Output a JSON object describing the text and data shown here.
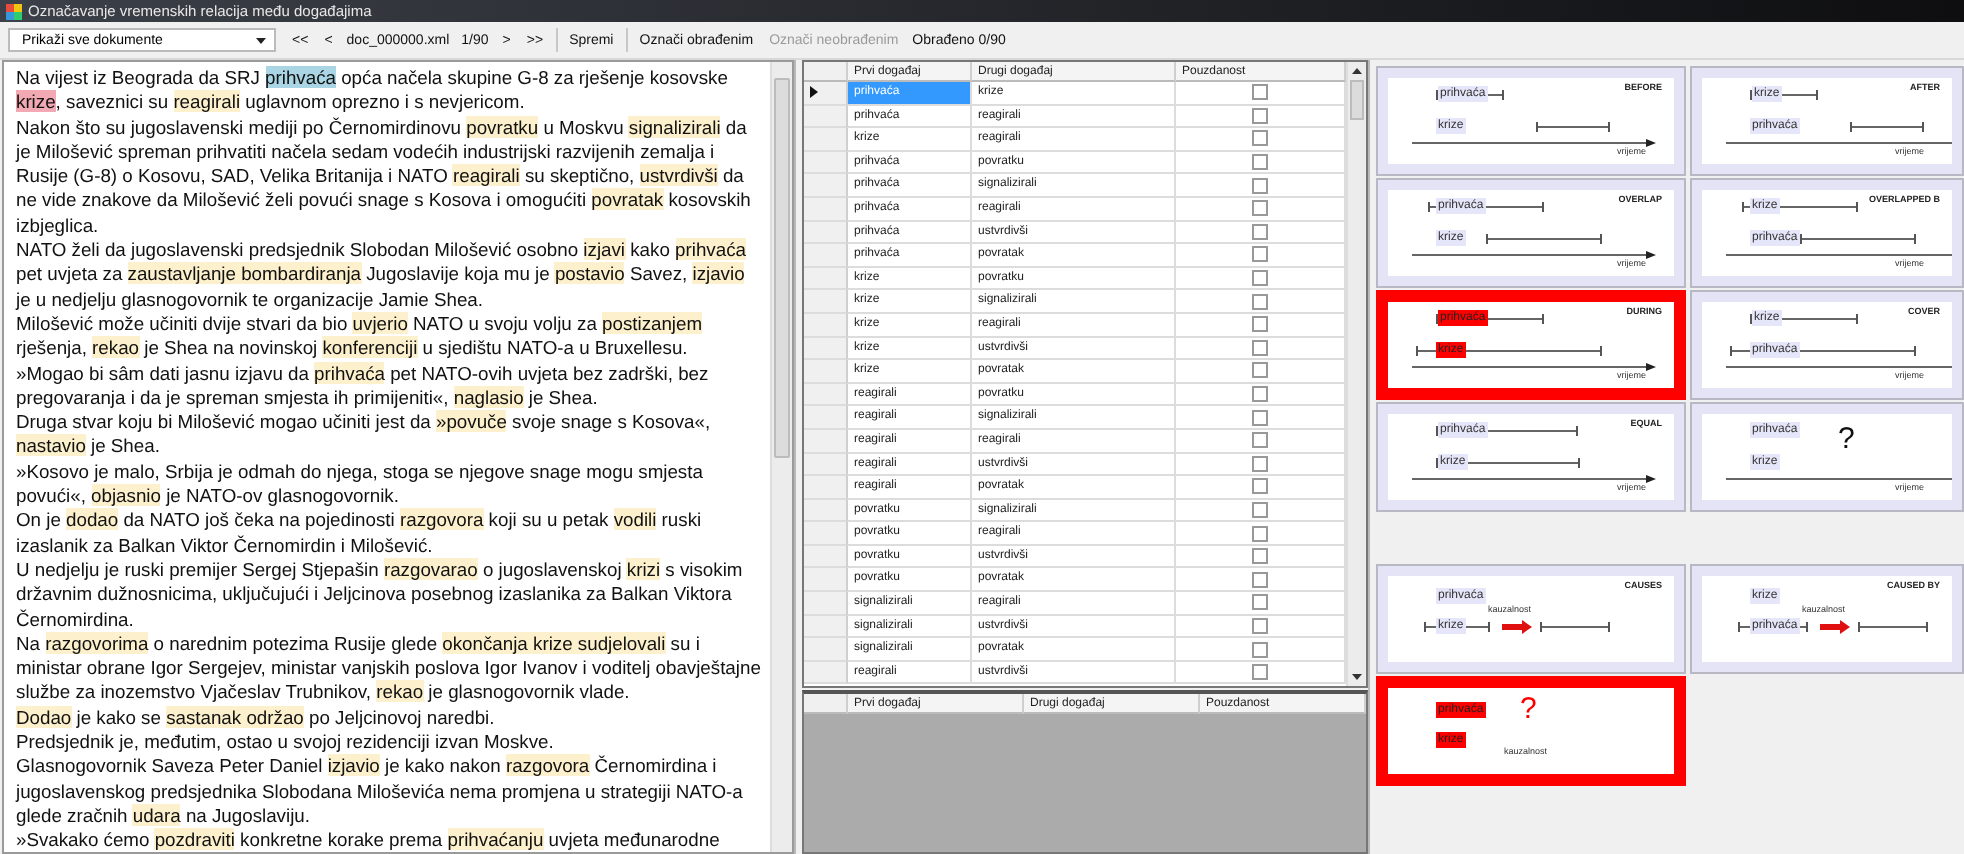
{
  "window": {
    "title": "Označavanje vremenskih relacija među događajima"
  },
  "toolbar": {
    "document_filter": "Prikaži sve dokumente",
    "items": [
      {
        "kind": "button",
        "label": "<<",
        "disabled": false
      },
      {
        "kind": "button",
        "label": "<",
        "disabled": false
      },
      {
        "kind": "label",
        "label": "doc_000000.xml"
      },
      {
        "kind": "label",
        "label": "1/90"
      },
      {
        "kind": "button",
        "label": ">",
        "disabled": false
      },
      {
        "kind": "button",
        "label": ">>",
        "disabled": false
      },
      {
        "kind": "separator"
      },
      {
        "kind": "button",
        "label": "Spremi",
        "disabled": false
      },
      {
        "kind": "separator"
      },
      {
        "kind": "button",
        "label": "Označi obrađenim",
        "disabled": false
      },
      {
        "kind": "button",
        "label": "Označi neobrađenim",
        "disabled": true
      },
      {
        "kind": "label",
        "label": "Obrađeno 0/90"
      }
    ]
  },
  "document": {
    "paragraphs": [
      [
        {
          "text": "Na vijest iz Beograda da SRJ ",
          "kind": "plain"
        },
        {
          "text": "prihvaća",
          "kind": "first"
        },
        {
          "text": " opća načela skupine G-8 za rješenje kosovske ",
          "kind": "plain"
        },
        {
          "text": "krize",
          "kind": "second"
        },
        {
          "text": ", saveznici su ",
          "kind": "plain"
        },
        {
          "text": "reagirali",
          "kind": "event"
        },
        {
          "text": " uglavnom oprezno i s nevjericom.",
          "kind": "plain"
        }
      ],
      [
        {
          "text": "Nakon što su jugoslavenski mediji po Černomirdinovu ",
          "kind": "plain"
        },
        {
          "text": "povratku",
          "kind": "event"
        },
        {
          "text": " u Moskvu ",
          "kind": "plain"
        },
        {
          "text": "signalizirali",
          "kind": "event"
        },
        {
          "text": " da je Milošević spreman prihvatiti načela sedam vodećih industrijski razvijenih zemalja i Rusije (G-8) o Kosovu, SAD, Velika Britanija i NATO ",
          "kind": "plain"
        },
        {
          "text": "reagirali",
          "kind": "event"
        },
        {
          "text": " su skeptično, ",
          "kind": "plain"
        },
        {
          "text": "ustvrdivši",
          "kind": "event"
        },
        {
          "text": " da ne vide znakove da Milošević želi povući snage s Kosova i omogućiti ",
          "kind": "plain"
        },
        {
          "text": "povratak",
          "kind": "event"
        },
        {
          "text": " kosovskih izbjeglica.",
          "kind": "plain"
        }
      ],
      [
        {
          "text": "NATO želi da jugoslavenski predsjednik Slobodan Milošević osobno ",
          "kind": "plain"
        },
        {
          "text": "izjavi",
          "kind": "event"
        },
        {
          "text": " kako ",
          "kind": "plain"
        },
        {
          "text": "prihvaća",
          "kind": "event"
        },
        {
          "text": " pet uvjeta za ",
          "kind": "plain"
        },
        {
          "text": "zaustavljanje bombardiranja",
          "kind": "event"
        },
        {
          "text": " Jugoslavije koja mu je ",
          "kind": "plain"
        },
        {
          "text": "postavio",
          "kind": "event"
        },
        {
          "text": " Savez, ",
          "kind": "plain"
        },
        {
          "text": "izjavio",
          "kind": "event"
        },
        {
          "text": " je u nedjelju glasnogovornik te organizacije Jamie Shea.",
          "kind": "plain"
        }
      ],
      [
        {
          "text": "Milošević može učiniti dvije stvari da bio ",
          "kind": "plain"
        },
        {
          "text": "uvjerio",
          "kind": "event"
        },
        {
          "text": " NATO u svoju volju za ",
          "kind": "plain"
        },
        {
          "text": "postizanjem",
          "kind": "event"
        },
        {
          "text": " rješenja, ",
          "kind": "plain"
        },
        {
          "text": "rekao",
          "kind": "event"
        },
        {
          "text": " je Shea na novinskoj ",
          "kind": "plain"
        },
        {
          "text": "konferenciji",
          "kind": "event"
        },
        {
          "text": " u sjedištu NATO-a u Bruxellesu.",
          "kind": "plain"
        }
      ],
      [
        {
          "text": "»Mogao bi sâm dati jasnu izjavu da ",
          "kind": "plain"
        },
        {
          "text": "prihvaća",
          "kind": "event"
        },
        {
          "text": " pet NATO-ovih uvjeta bez zadrški, bez pregovaranja i da je spreman smjesta ih primijeniti«, ",
          "kind": "plain"
        },
        {
          "text": "naglasio",
          "kind": "event"
        },
        {
          "text": " je Shea.",
          "kind": "plain"
        }
      ],
      [
        {
          "text": "Druga stvar koju bi Milošević mogao učiniti jest da ",
          "kind": "plain"
        },
        {
          "text": "»povuče",
          "kind": "event"
        },
        {
          "text": " svoje snage s Kosova«, ",
          "kind": "plain"
        },
        {
          "text": "nastavio",
          "kind": "event"
        },
        {
          "text": " je Shea.",
          "kind": "plain"
        }
      ],
      [
        {
          "text": "»Kosovo je malo, Srbija je odmah do njega, stoga se njegove snage mogu smjesta povući«, ",
          "kind": "plain"
        },
        {
          "text": "objasnio",
          "kind": "event"
        },
        {
          "text": " je NATO-ov glasnogovornik.",
          "kind": "plain"
        }
      ],
      [
        {
          "text": "On je ",
          "kind": "plain"
        },
        {
          "text": "dodao",
          "kind": "event"
        },
        {
          "text": " da NATO još čeka na pojedinosti ",
          "kind": "plain"
        },
        {
          "text": "razgovora",
          "kind": "event"
        },
        {
          "text": " koji su u petak ",
          "kind": "plain"
        },
        {
          "text": "vodili",
          "kind": "event"
        },
        {
          "text": " ruski izaslanik za Balkan Viktor Černomirdin i Milošević.",
          "kind": "plain"
        }
      ],
      [
        {
          "text": "U nedjelju je ruski premijer Sergej Stjepašin ",
          "kind": "plain"
        },
        {
          "text": "razgovarao",
          "kind": "event"
        },
        {
          "text": " o jugoslavenskoj ",
          "kind": "plain"
        },
        {
          "text": "krizi",
          "kind": "event"
        },
        {
          "text": " s visokim državnim dužnosnicima, uključujući i Jeljcinova posebnog izaslanika za Balkan Viktora Černomirdina.",
          "kind": "plain"
        }
      ],
      [
        {
          "text": "Na ",
          "kind": "plain"
        },
        {
          "text": "razgovorima",
          "kind": "event"
        },
        {
          "text": " o narednim potezima Rusije glede ",
          "kind": "plain"
        },
        {
          "text": "okončanja ",
          "kind": "event"
        },
        {
          "text": "krize ",
          "kind": "event"
        },
        {
          "text": "sudjelovali",
          "kind": "event"
        },
        {
          "text": " su i ministar obrane Igor Sergejev, ministar vanjskih poslova Igor Ivanov i voditelj obavještajne službe za inozemstvo Vjačeslav Trubnikov, ",
          "kind": "plain"
        },
        {
          "text": "rekao",
          "kind": "event"
        },
        {
          "text": " je glasnogovornik vlade.",
          "kind": "plain"
        }
      ],
      [
        {
          "text": "Dodao",
          "kind": "event"
        },
        {
          "text": " je kako se ",
          "kind": "plain"
        },
        {
          "text": "sastanak ",
          "kind": "event"
        },
        {
          "text": "održao",
          "kind": "event"
        },
        {
          "text": " po Jeljcinovoj naredbi.",
          "kind": "plain"
        }
      ],
      [
        {
          "text": "Predsjednik je, međutim, ostao u svojoj rezidenciji izvan Moskve.",
          "kind": "plain"
        }
      ],
      [
        {
          "text": "Glasnogovornik Saveza Peter Daniel ",
          "kind": "plain"
        },
        {
          "text": "izjavio",
          "kind": "event"
        },
        {
          "text": " je kako nakon ",
          "kind": "plain"
        },
        {
          "text": "razgovora",
          "kind": "event"
        },
        {
          "text": " Černomirdina i jugoslavenskog predsjednika Slobodana Miloševića nema promjena u strategiji NATO-a glede zračnih ",
          "kind": "plain"
        },
        {
          "text": "udara",
          "kind": "event"
        },
        {
          "text": " na Jugoslaviju.",
          "kind": "plain"
        }
      ],
      [
        {
          "text": "»Svakako ćemo ",
          "kind": "plain"
        },
        {
          "text": "pozdraviti",
          "kind": "event"
        },
        {
          "text": " konkretne korake prema ",
          "kind": "plain"
        },
        {
          "text": "prihvaćanju",
          "kind": "event"
        },
        {
          "text": " uvjeta međunarodne",
          "kind": "plain"
        }
      ]
    ]
  },
  "table": {
    "columns": [
      "Prvi događaj",
      "Drugi događaj",
      "Pouzdanost"
    ],
    "rows": [
      {
        "first": "prihvaća",
        "second": "krize",
        "checked": false,
        "selected": true
      },
      {
        "first": "prihvaća",
        "second": "reagirali",
        "checked": false,
        "selected": false
      },
      {
        "first": "krize",
        "second": "reagirali",
        "checked": false,
        "selected": false
      },
      {
        "first": "prihvaća",
        "second": "povratku",
        "checked": false,
        "selected": false
      },
      {
        "first": "prihvaća",
        "second": "signalizirali",
        "checked": false,
        "selected": false
      },
      {
        "first": "prihvaća",
        "second": "reagirali",
        "checked": false,
        "selected": false
      },
      {
        "first": "prihvaća",
        "second": "ustvrdivši",
        "checked": false,
        "selected": false
      },
      {
        "first": "prihvaća",
        "second": "povratak",
        "checked": false,
        "selected": false
      },
      {
        "first": "krize",
        "second": "povratku",
        "checked": false,
        "selected": false
      },
      {
        "first": "krize",
        "second": "signalizirali",
        "checked": false,
        "selected": false
      },
      {
        "first": "krize",
        "second": "reagirali",
        "checked": false,
        "selected": false
      },
      {
        "first": "krize",
        "second": "ustvrdivši",
        "checked": false,
        "selected": false
      },
      {
        "first": "krize",
        "second": "povratak",
        "checked": false,
        "selected": false
      },
      {
        "first": "reagirali",
        "second": "povratku",
        "checked": false,
        "selected": false
      },
      {
        "first": "reagirali",
        "second": "signalizirali",
        "checked": false,
        "selected": false
      },
      {
        "first": "reagirali",
        "second": "reagirali",
        "checked": false,
        "selected": false
      },
      {
        "first": "reagirali",
        "second": "ustvrdivši",
        "checked": false,
        "selected": false
      },
      {
        "first": "reagirali",
        "second": "povratak",
        "checked": false,
        "selected": false
      },
      {
        "first": "povratku",
        "second": "signalizirali",
        "checked": false,
        "selected": false
      },
      {
        "first": "povratku",
        "second": "reagirali",
        "checked": false,
        "selected": false
      },
      {
        "first": "povratku",
        "second": "ustvrdivši",
        "checked": false,
        "selected": false
      },
      {
        "first": "povratku",
        "second": "povratak",
        "checked": false,
        "selected": false
      },
      {
        "first": "signalizirali",
        "second": "reagirali",
        "checked": false,
        "selected": false
      },
      {
        "first": "signalizirali",
        "second": "ustvrdivši",
        "checked": false,
        "selected": false
      },
      {
        "first": "signalizirali",
        "second": "povratak",
        "checked": false,
        "selected": false
      },
      {
        "first": "reagirali",
        "second": "ustvrdivši",
        "checked": false,
        "selected": false
      }
    ]
  },
  "result_table": {
    "columns": [
      "Prvi događaj",
      "Drugi događaj",
      "Pouzdanost"
    ]
  },
  "temporal_relations": [
    {
      "kind": "before",
      "title": "BEFORE",
      "top_label": "prihvaća",
      "bottom_label": "krize",
      "axis_label": "vrijeme",
      "selected": false
    },
    {
      "kind": "after",
      "title": "AFTER",
      "top_label": "krize",
      "bottom_label": "prihvaća",
      "axis_label": "vrijeme",
      "selected": false
    },
    {
      "kind": "overlap",
      "title": "OVERLAP",
      "top_label": "prihvaća",
      "bottom_label": "krize",
      "axis_label": "vrijeme",
      "selected": false
    },
    {
      "kind": "overlapped_by",
      "title": "OVERLAPPED B",
      "top_label": "krize",
      "bottom_label": "prihvaća",
      "axis_label": "vrijeme",
      "selected": false
    },
    {
      "kind": "during",
      "title": "DURING",
      "top_label": "prihvaća",
      "bottom_label": "krize",
      "axis_label": "vrijeme",
      "selected": true
    },
    {
      "kind": "covers",
      "title": "COVER",
      "top_label": "krize",
      "bottom_label": "prihvaća",
      "axis_label": "vrijeme",
      "selected": false
    },
    {
      "kind": "equal",
      "title": "EQUAL",
      "top_label": "prihvaća",
      "bottom_label": "krize",
      "axis_label": "vrijeme",
      "selected": false
    },
    {
      "kind": "unknown",
      "mark": "?",
      "top_label": "prihvaća",
      "bottom_label": "krize",
      "axis_label": "vrijeme",
      "selected": false
    }
  ],
  "causal_relations": [
    {
      "kind": "causes",
      "title": "CAUSES",
      "top_label": "prihvaća",
      "bottom_label": "krize",
      "causal_label": "kauzalnost",
      "selected": false
    },
    {
      "kind": "caused_by",
      "title": "CAUSED BY",
      "top_label": "krize",
      "bottom_label": "prihvaća",
      "causal_label": "kauzalnost",
      "selected": false
    },
    {
      "kind": "unknown_causal",
      "mark": "?",
      "top_label": "prihvaća",
      "bottom_label": "krize",
      "causal_label": "kauzalnost",
      "selected": true
    }
  ]
}
